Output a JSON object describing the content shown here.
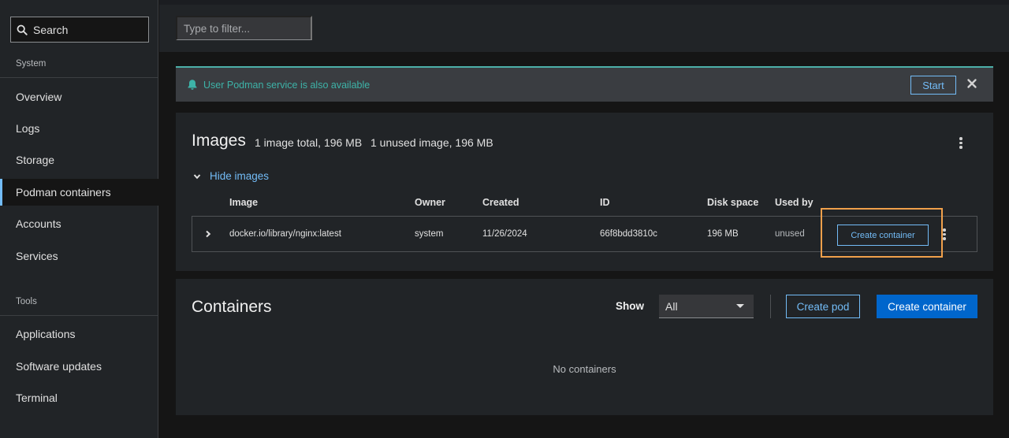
{
  "sidebar": {
    "search_label": "Search",
    "sections": [
      {
        "label": "System"
      },
      {
        "label": "Tools"
      }
    ],
    "system_items": [
      {
        "label": "Overview"
      },
      {
        "label": "Logs"
      },
      {
        "label": "Storage"
      },
      {
        "label": "Podman containers"
      },
      {
        "label": "Accounts"
      },
      {
        "label": "Services"
      }
    ],
    "tool_items": [
      {
        "label": "Applications"
      },
      {
        "label": "Software updates"
      },
      {
        "label": "Terminal"
      }
    ],
    "active_item": "Podman containers"
  },
  "filter": {
    "placeholder": "Type to filter..."
  },
  "alert": {
    "message": "User Podman service is also available",
    "start_label": "Start",
    "accent": "#4cb0a8"
  },
  "images": {
    "title": "Images",
    "total": "1 image total, 196 MB",
    "unused": "1 unused image, 196 MB",
    "toggle_label": "Hide images",
    "columns": [
      "Image",
      "Owner",
      "Created",
      "ID",
      "Disk space",
      "Used by"
    ],
    "rows": [
      {
        "image": "docker.io/library/nginx:latest",
        "owner": "system",
        "created": "11/26/2024",
        "id": "66f8bdd3810c",
        "disk_space": "196 MB",
        "used_by": "unused",
        "action_label": "Create container"
      }
    ]
  },
  "containers": {
    "title": "Containers",
    "show_label": "Show",
    "show_value": "All",
    "create_pod_label": "Create pod",
    "create_container_label": "Create container",
    "empty_text": "No containers"
  },
  "colors": {
    "link": "#73bcf7",
    "primary": "#0066cc",
    "highlight": "#f0a04b"
  }
}
